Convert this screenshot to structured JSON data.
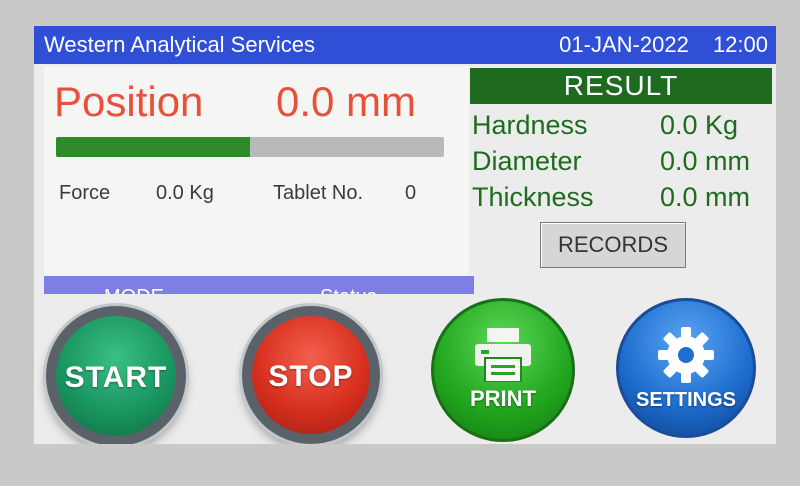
{
  "header": {
    "title": "Western Analytical Services",
    "date": "01-JAN-2022",
    "time": "12:00"
  },
  "position": {
    "label": "Position",
    "value": "0.0 mm",
    "progress_percent": 50
  },
  "force": {
    "label": "Force",
    "value": "0.0 Kg"
  },
  "tablet": {
    "label": "Tablet No.",
    "value": "0"
  },
  "mode_bar": {
    "mode_label": "MODE",
    "status_label": "Status"
  },
  "result": {
    "title": "RESULT",
    "rows": [
      {
        "label": "Hardness",
        "value": "0.0 Kg"
      },
      {
        "label": "Diameter",
        "value": "0.0 mm"
      },
      {
        "label": "Thickness",
        "value": "0.0 mm"
      }
    ]
  },
  "records_button": "RECORDS",
  "buttons": {
    "start": "START",
    "stop": "STOP",
    "print": "PRINT",
    "settings": "SETTINGS"
  },
  "colors": {
    "title_bar": "#2f4fd6",
    "position_text": "#e8503a",
    "progress_fill": "#2f8a2a",
    "mode_bar": "#7d7ee6",
    "result_header": "#1e6a1e",
    "result_text": "#1f6b1f",
    "start": "#1a9660",
    "stop": "#d8301f",
    "print": "#24a820",
    "settings": "#1f6fd0"
  },
  "icons": {
    "print": "printer-icon",
    "settings": "gear-icon"
  }
}
